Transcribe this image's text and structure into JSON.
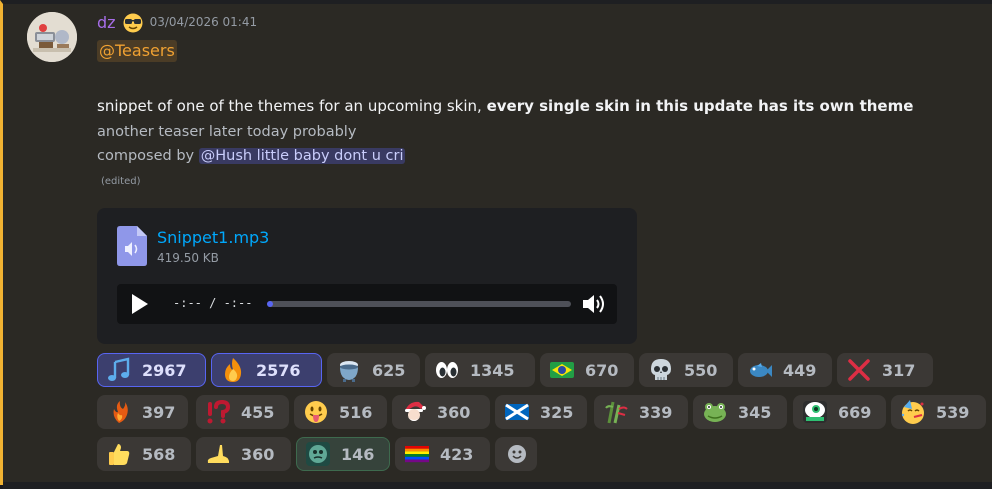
{
  "message": {
    "username": "dz",
    "timestamp": "03/04/2026 01:41",
    "role_mention": "@Teasers",
    "text_plain": "snippet of one of the themes for an upcoming skin, ",
    "text_bold": "every single skin in this update has its own theme",
    "line2": "another teaser later today probably",
    "line3_prefix": "composed by ",
    "user_mention": "@Hush little baby dont u cri",
    "edited": "(edited)"
  },
  "attachment": {
    "file_name": "Snippet1.mp3",
    "file_size": "419.50 KB",
    "time_display": "-:-- / -:--",
    "progress": 0.02
  },
  "reactions": [
    {
      "emoji": "musical-note",
      "count": "2967",
      "me": true
    },
    {
      "emoji": "fire",
      "count": "2576",
      "me": true
    },
    {
      "emoji": "cauldron",
      "count": "625"
    },
    {
      "emoji": "eyes",
      "count": "1345"
    },
    {
      "emoji": "flag-brazil",
      "count": "670"
    },
    {
      "emoji": "skull",
      "count": "550"
    },
    {
      "emoji": "fish",
      "count": "449"
    },
    {
      "emoji": "cross-mark",
      "count": "317"
    },
    {
      "emoji": "phoenix",
      "count": "397"
    },
    {
      "emoji": "interrobang",
      "count": "455"
    },
    {
      "emoji": "tongue-face",
      "count": "516"
    },
    {
      "emoji": "santa",
      "count": "360"
    },
    {
      "emoji": "flag-scotland",
      "count": "325"
    },
    {
      "emoji": "bamboo",
      "count": "339"
    },
    {
      "emoji": "frog",
      "count": "345"
    },
    {
      "emoji": "custom-green-eye",
      "count": "669"
    },
    {
      "emoji": "partying-face",
      "count": "539"
    },
    {
      "emoji": "thumbs-up",
      "count": "568"
    },
    {
      "emoji": "foot",
      "count": "360"
    },
    {
      "emoji": "custom-avatar",
      "count": "146",
      "highlight": true
    },
    {
      "emoji": "rainbow-flag",
      "count": "423"
    },
    {
      "emoji": "add-reaction",
      "count": ""
    }
  ],
  "colors": {
    "username": "#a66de8",
    "role_mention": "#f0a132",
    "link": "#00a8fc",
    "accent_border": "#f0b232",
    "reaction_me": "#5865f2"
  }
}
